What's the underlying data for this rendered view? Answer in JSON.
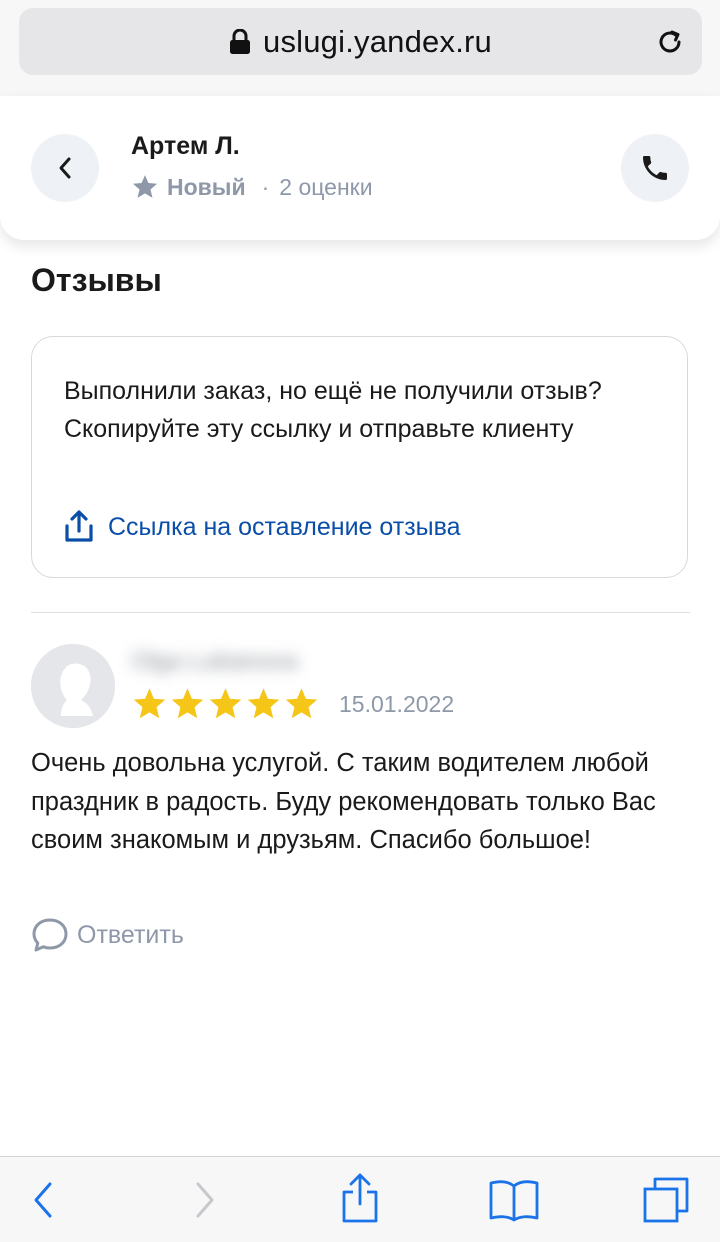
{
  "browser": {
    "url": "uslugi.yandex.ru",
    "icons": {
      "lock": "lock-icon",
      "reload": "reload-icon"
    }
  },
  "profile": {
    "name": "Артем Л.",
    "status": "Новый",
    "separator": "·",
    "ratings_count": "2 оценки",
    "icons": {
      "back": "chevron-left-icon",
      "call": "phone-icon",
      "status": "star-icon"
    }
  },
  "reviews": {
    "title": "Отзывы",
    "info_text": "Выполнили заказ, но ещё не получили отзыв? Скопируйте эту ссылку и отправьте клиенту",
    "share_link": "Ссылка на оставление отзыва",
    "items": [
      {
        "author": "Olga Lukianova",
        "stars": 5,
        "date": "15.01.2022",
        "text": "Очень довольна услугой. С таким водителем любой праздник в радость. Буду рекомендовать только Вас своим знакомым и друзьям. Спасибо большое!",
        "reply_label": "Ответить"
      }
    ]
  },
  "toolbar": {
    "icons": [
      "back-icon",
      "forward-icon",
      "share-icon",
      "bookmarks-icon",
      "tabs-icon"
    ]
  },
  "colors": {
    "accent_link": "#0b4ea8",
    "star": "#f5c518",
    "muted": "#8e98a8",
    "ios_blue": "#1a73e8"
  }
}
